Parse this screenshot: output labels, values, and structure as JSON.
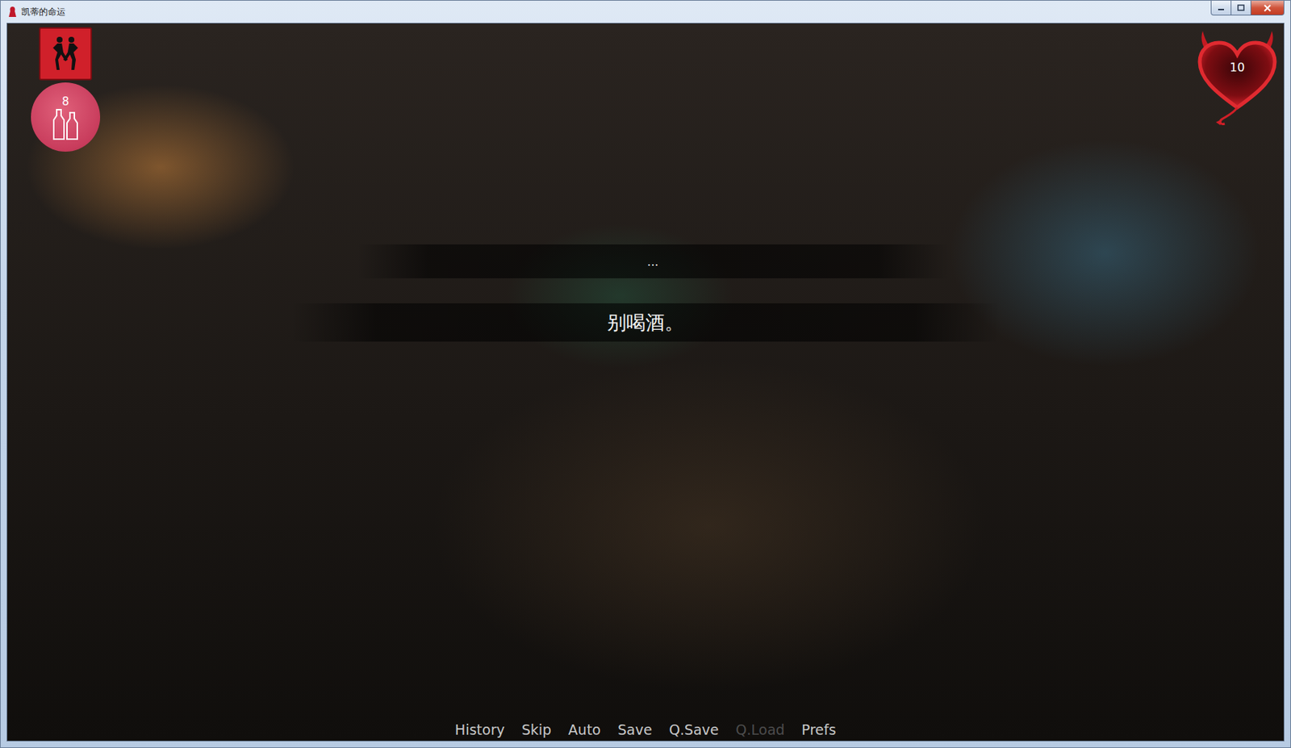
{
  "window": {
    "title": "凯蒂的命运"
  },
  "hud": {
    "stat_badge": "8",
    "heart_counter": "10"
  },
  "dialogue": {
    "speaker": "...",
    "line": "别喝酒。"
  },
  "quick_menu": [
    {
      "label": "History",
      "disabled": false
    },
    {
      "label": "Skip",
      "disabled": false
    },
    {
      "label": "Auto",
      "disabled": false
    },
    {
      "label": "Save",
      "disabled": false
    },
    {
      "label": "Q.Save",
      "disabled": false
    },
    {
      "label": "Q.Load",
      "disabled": true
    },
    {
      "label": "Prefs",
      "disabled": false
    }
  ]
}
